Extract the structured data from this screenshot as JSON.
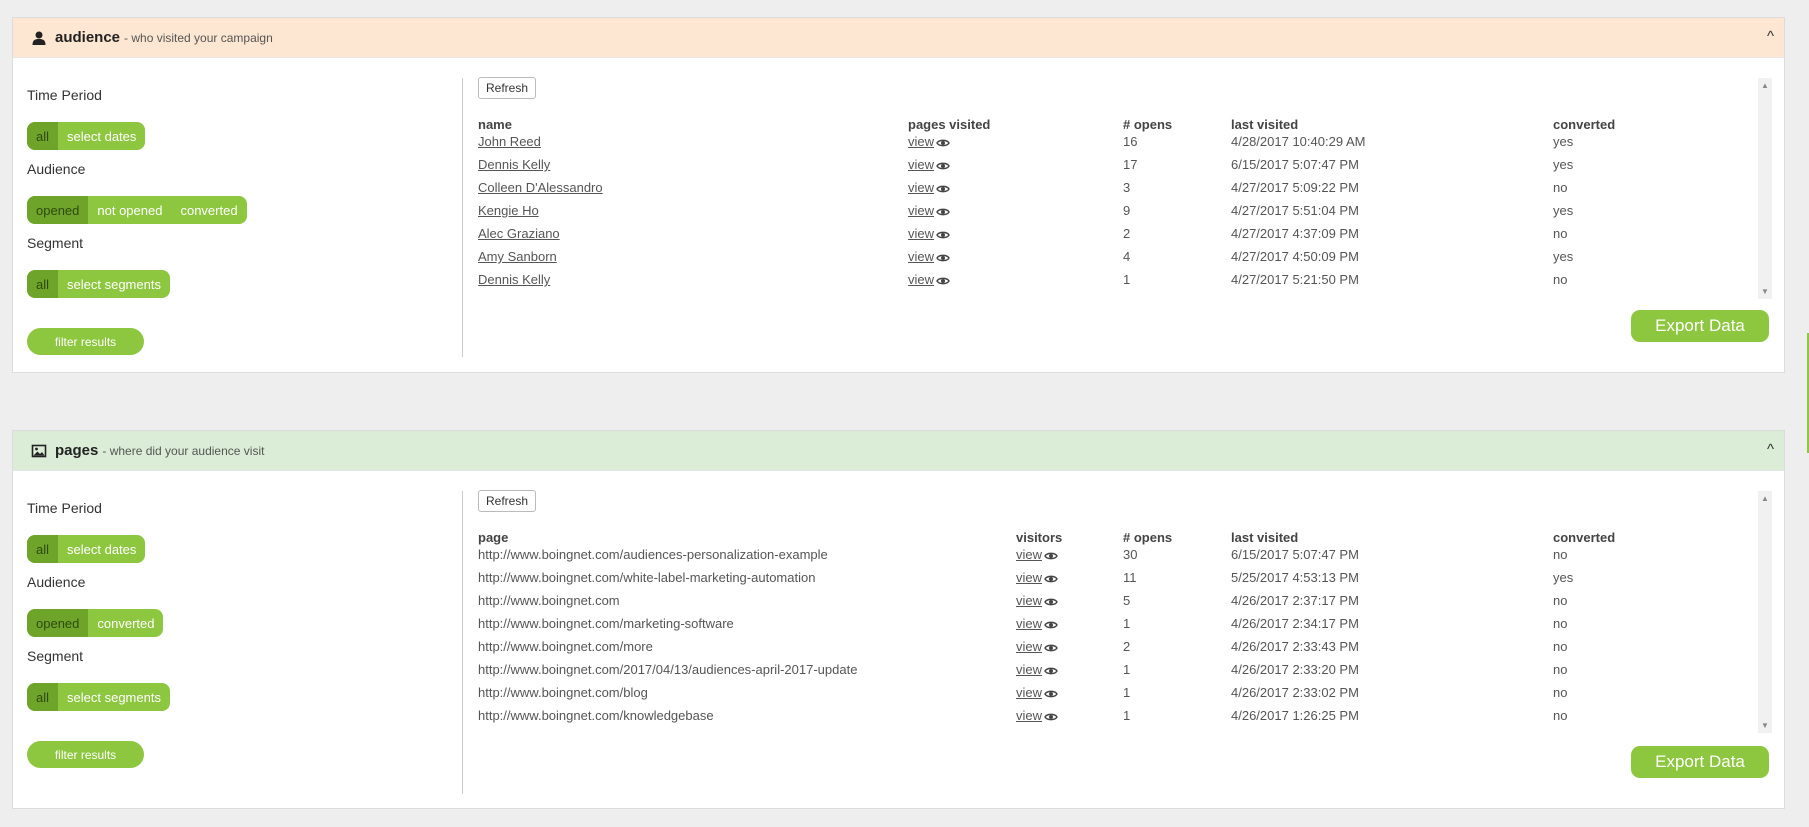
{
  "audience": {
    "title": "audience",
    "subtitle": "- who visited your campaign",
    "collapse": "^",
    "time_period_label": "Time Period",
    "time_options": [
      "all",
      "select dates"
    ],
    "audience_label": "Audience",
    "audience_options": [
      "opened",
      "not opened",
      "converted"
    ],
    "segment_label": "Segment",
    "segment_options": [
      "all",
      "select segments"
    ],
    "filter_label": "filter results",
    "refresh_label": "Refresh",
    "columns": [
      "name",
      "pages visited",
      "# opens",
      "last visited",
      "converted"
    ],
    "rows": [
      {
        "name": "John Reed",
        "pages": "view",
        "opens": "16",
        "last": "4/28/2017 10:40:29 AM",
        "converted": "yes"
      },
      {
        "name": "Dennis Kelly",
        "pages": "view",
        "opens": "17",
        "last": "6/15/2017 5:07:47 PM",
        "converted": "yes"
      },
      {
        "name": "Colleen D'Alessandro",
        "pages": "view",
        "opens": "3",
        "last": "4/27/2017 5:09:22 PM",
        "converted": "no"
      },
      {
        "name": "Kengie Ho",
        "pages": "view",
        "opens": "9",
        "last": "4/27/2017 5:51:04 PM",
        "converted": "yes"
      },
      {
        "name": "Alec Graziano",
        "pages": "view",
        "opens": "2",
        "last": "4/27/2017 4:37:09 PM",
        "converted": "no"
      },
      {
        "name": "Amy Sanborn",
        "pages": "view",
        "opens": "4",
        "last": "4/27/2017 4:50:09 PM",
        "converted": "yes"
      },
      {
        "name": "Dennis Kelly",
        "pages": "view",
        "opens": "1",
        "last": "4/27/2017 5:21:50 PM",
        "converted": "no"
      }
    ],
    "export_label": "Export Data"
  },
  "pages": {
    "title": "pages",
    "subtitle": "- where did your audience visit",
    "collapse": "^",
    "time_period_label": "Time Period",
    "time_options": [
      "all",
      "select dates"
    ],
    "audience_label": "Audience",
    "audience_options": [
      "opened",
      "converted"
    ],
    "segment_label": "Segment",
    "segment_options": [
      "all",
      "select segments"
    ],
    "filter_label": "filter results",
    "refresh_label": "Refresh",
    "columns": [
      "page",
      "visitors",
      "# opens",
      "last visited",
      "converted"
    ],
    "rows": [
      {
        "page": "http://www.boingnet.com/audiences-personalization-example",
        "visitors": "view",
        "opens": "30",
        "last": "6/15/2017 5:07:47 PM",
        "converted": "no"
      },
      {
        "page": "http://www.boingnet.com/white-label-marketing-automation",
        "visitors": "view",
        "opens": "11",
        "last": "5/25/2017 4:53:13 PM",
        "converted": "yes"
      },
      {
        "page": "http://www.boingnet.com",
        "visitors": "view",
        "opens": "5",
        "last": "4/26/2017 2:37:17 PM",
        "converted": "no"
      },
      {
        "page": "http://www.boingnet.com/marketing-software",
        "visitors": "view",
        "opens": "1",
        "last": "4/26/2017 2:34:17 PM",
        "converted": "no"
      },
      {
        "page": "http://www.boingnet.com/more",
        "visitors": "view",
        "opens": "2",
        "last": "4/26/2017 2:33:43 PM",
        "converted": "no"
      },
      {
        "page": "http://www.boingnet.com/2017/04/13/audiences-april-2017-update",
        "visitors": "view",
        "opens": "1",
        "last": "4/26/2017 2:33:20 PM",
        "converted": "no"
      },
      {
        "page": "http://www.boingnet.com/blog",
        "visitors": "view",
        "opens": "1",
        "last": "4/26/2017 2:33:02 PM",
        "converted": "no"
      },
      {
        "page": "http://www.boingnet.com/knowledgebase",
        "visitors": "view",
        "opens": "1",
        "last": "4/26/2017 1:26:25 PM",
        "converted": "no"
      }
    ],
    "export_label": "Export Data"
  },
  "icons": {
    "audience": "user-icon",
    "pages": "image-icon",
    "view": "eye-icon"
  },
  "colors": {
    "accent": "#8dc63f",
    "accent_dark": "#6ea42a",
    "audience_header": "#fde6d2",
    "pages_header": "#dbedd6"
  }
}
